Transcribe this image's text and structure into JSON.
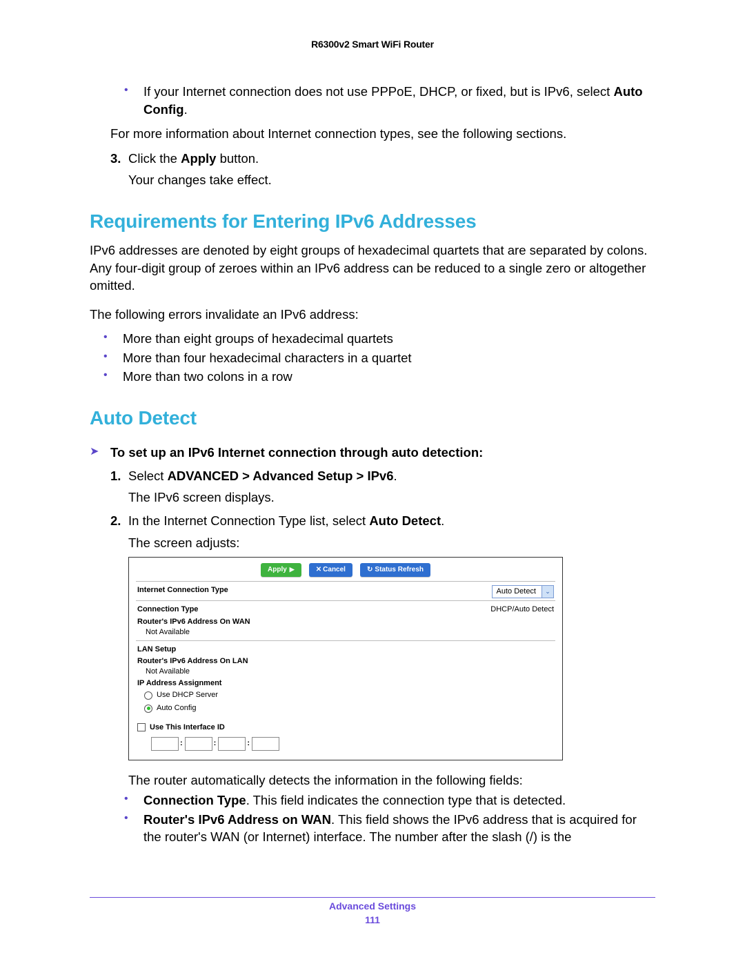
{
  "doc": {
    "header": "R6300v2 Smart WiFi Router",
    "footer_title": "Advanced Settings",
    "page_number": "111"
  },
  "intro": {
    "bullet1_a": "If your Internet connection does not use PPPoE, DHCP, or fixed, but is IPv6, select ",
    "bullet1_b": "Auto Config",
    "bullet1_c": ".",
    "para_more": "For more information about Internet connection types, see the following sections.",
    "step3_a": "Click the ",
    "step3_b": "Apply",
    "step3_c": " button.",
    "step3_sub": "Your changes take effect."
  },
  "ipv6req": {
    "title": "Requirements for Entering IPv6 Addresses",
    "p1": "IPv6 addresses are denoted by eight groups of hexadecimal quartets that are separated by colons. Any four-digit group of zeroes within an IPv6 address can be reduced to a single zero or altogether omitted.",
    "p2": "The following errors invalidate an IPv6 address:",
    "b1": "More than eight groups of hexadecimal quartets",
    "b2": "More than four hexadecimal characters in a quartet",
    "b3": "More than two colons in a row"
  },
  "autodetect": {
    "title": "Auto Detect",
    "tri_label": "To set up an IPv6 Internet connection through auto detection:",
    "s1_a": "Select ",
    "s1_b": "ADVANCED > Advanced Setup > IPv6",
    "s1_c": ".",
    "s1_sub": "The IPv6 screen displays.",
    "s2_a": "In the Internet Connection Type list, select ",
    "s2_b": "Auto Detect",
    "s2_c": ".",
    "s2_sub": "The screen adjusts:",
    "after_shot": "The router automatically detects the information in the following fields:",
    "b1_a": "Connection Type",
    "b1_b": ". This field indicates the connection type that is detected.",
    "b2_a": "Router's IPv6 Address on WAN",
    "b2_b": ". This field shows the IPv6 address that is acquired for the router's WAN (or Internet) interface. The number after the slash (/) is the"
  },
  "shot": {
    "btn_apply": "Apply",
    "btn_cancel": "Cancel",
    "btn_status": "Status Refresh",
    "row_ict": "Internet Connection Type",
    "dd_value": "Auto Detect",
    "row_ctype": "Connection Type",
    "ctype_value": "DHCP/Auto Detect",
    "row_wan": "Router's IPv6 Address On WAN",
    "not_available": "Not Available",
    "lan_setup": "LAN Setup",
    "row_lan": "Router's IPv6 Address On LAN",
    "ip_assign": "IP Address Assignment",
    "radio_dhcp": "Use DHCP Server",
    "radio_auto": "Auto Config",
    "use_iface": "Use This Interface ID"
  }
}
